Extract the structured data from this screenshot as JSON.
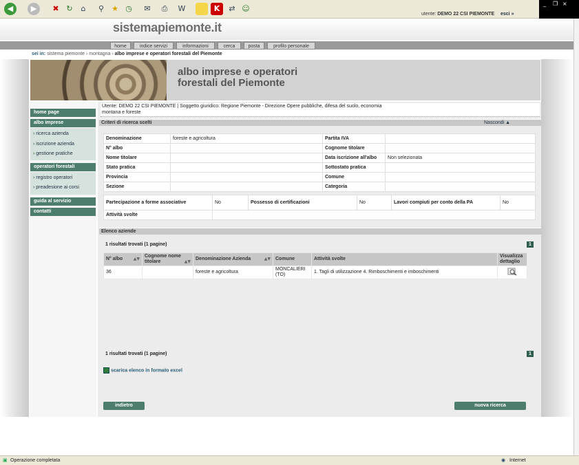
{
  "site": {
    "title": "sistemapiemonte.it",
    "user_label": "utente:",
    "user_name": "DEMO 22 CSI PIEMONTE",
    "logout": "esci »"
  },
  "topnav": [
    "home",
    "indice servizi",
    "informazioni",
    "cerca",
    "posta",
    "profilo personale"
  ],
  "breadcrumb": {
    "label": "sei in:",
    "path": "sistema piemonte › montagna ›",
    "current": "albo imprese e operatori forestali del Piemonte"
  },
  "banner": {
    "line1": "albo imprese e operatori",
    "line2": "forestali del Piemonte"
  },
  "sidebar": {
    "home": "home page",
    "albo": "albo imprese",
    "albo_items": [
      "ricerca azienda",
      "iscrizione azienda",
      "gestione pratiche"
    ],
    "operatori": "operatori forestali",
    "operatori_items": [
      "registro operatori",
      "preadesione ai corsi"
    ],
    "guida": "guida al servizio",
    "contatti": "contatti"
  },
  "user_strip": {
    "line1": "Utente: DEMO 22 CSI PIEMONTE | Soggetto giuridico: Regione Piemonte - Direzione Opere pubbliche, difesa del suolo, economia",
    "line2": "montana e foreste"
  },
  "criteria": {
    "title": "Criteri di ricerca scelti",
    "hide": "Nascondi ▲",
    "denominazione_label": "Denominazione",
    "denominazione_value": "foreste e agricoltura",
    "piva_label": "Partita IVA",
    "nalbo_label": "N° albo",
    "cognome_label": "Cognome titolare",
    "nome_label": "Nome titolare",
    "data_label": "Data iscrizione all'albo",
    "data_value": "Non selezionata",
    "stato_label": "Stato pratica",
    "sottostato_label": "Sottostato pratica",
    "provincia_label": "Provincia",
    "comune_label": "Comune",
    "sezione_label": "Sezione",
    "categoria_label": "Categoria",
    "partecipazione_label": "Partecipazione a forme associative",
    "partecipazione_value": "No",
    "certificazioni_label": "Possesso di certificazioni",
    "certificazioni_value": "No",
    "lavori_label": "Lavori compiuti per conto della PA",
    "lavori_value": "No",
    "attivita_label": "Attività svolte"
  },
  "results": {
    "title": "Elenco aziende",
    "count_text": "1 risultati trovati (1 pagine)",
    "page": "1",
    "headers": [
      "N° albo",
      "Cognome nome titolare",
      "Denominazione Azienda",
      "Comune",
      "Attività svolte",
      "Visualizza dettaglio"
    ],
    "rows": [
      {
        "nalbo": "36",
        "titolare": "",
        "denominazione": "foreste e agricoltura",
        "comune": "MONCALIERI (TO)",
        "attivita": "1. Tagli di utilizzazione 4. Rimboschimenti e imboschimenti"
      }
    ],
    "excel": "scarica elenco in formato excel"
  },
  "buttons": {
    "back": "indietro",
    "new_search": "nuova ricerca"
  },
  "status": {
    "left": "Operazione completata",
    "right": "Internet"
  }
}
